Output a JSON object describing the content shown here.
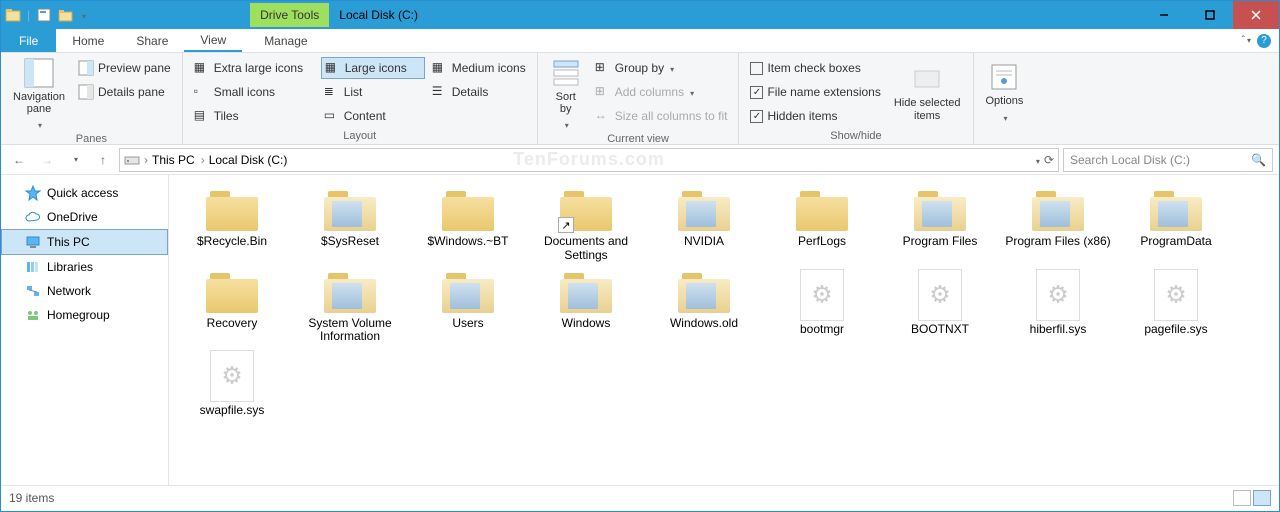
{
  "titlebar": {
    "drive_tools": "Drive Tools",
    "title": "Local Disk (C:)"
  },
  "tabs": {
    "file": "File",
    "home": "Home",
    "share": "Share",
    "view": "View",
    "manage": "Manage"
  },
  "ribbon": {
    "panes": {
      "nav": "Navigation\npane",
      "preview": "Preview pane",
      "details": "Details pane",
      "group": "Panes"
    },
    "layout": {
      "xl": "Extra large icons",
      "lg": "Large icons",
      "md": "Medium icons",
      "sm": "Small icons",
      "list": "List",
      "det": "Details",
      "tiles": "Tiles",
      "content": "Content",
      "group": "Layout"
    },
    "current": {
      "sort": "Sort\nby",
      "groupby": "Group by",
      "addcols": "Add columns",
      "sizecols": "Size all columns to fit",
      "group": "Current view"
    },
    "showhide": {
      "itemcheck": "Item check boxes",
      "fne": "File name extensions",
      "hidden": "Hidden items",
      "hidesel": "Hide selected\nitems",
      "group": "Show/hide"
    },
    "options": {
      "label": "Options"
    }
  },
  "breadcrumb": {
    "root": "This PC",
    "drive": "Local Disk (C:)"
  },
  "search": {
    "placeholder": "Search Local Disk (C:)"
  },
  "watermark": "TenForums.com",
  "sidebar": {
    "items": [
      {
        "label": "Quick access",
        "icon": "star"
      },
      {
        "label": "OneDrive",
        "icon": "cloud"
      },
      {
        "label": "This PC",
        "icon": "pc",
        "selected": true
      },
      {
        "label": "Libraries",
        "icon": "lib"
      },
      {
        "label": "Network",
        "icon": "net"
      },
      {
        "label": "Homegroup",
        "icon": "home"
      }
    ]
  },
  "files": [
    {
      "name": "$Recycle.Bin",
      "type": "folder"
    },
    {
      "name": "$SysReset",
      "type": "folder-open"
    },
    {
      "name": "$Windows.~BT",
      "type": "folder"
    },
    {
      "name": "Documents and Settings",
      "type": "folder",
      "shortcut": true
    },
    {
      "name": "NVIDIA",
      "type": "folder-open"
    },
    {
      "name": "PerfLogs",
      "type": "folder"
    },
    {
      "name": "Program Files",
      "type": "folder-open"
    },
    {
      "name": "Program Files (x86)",
      "type": "folder-open"
    },
    {
      "name": "ProgramData",
      "type": "folder-open"
    },
    {
      "name": "Recovery",
      "type": "folder"
    },
    {
      "name": "System Volume Information",
      "type": "folder-open"
    },
    {
      "name": "Users",
      "type": "folder-open"
    },
    {
      "name": "Windows",
      "type": "folder-open"
    },
    {
      "name": "Windows.old",
      "type": "folder-open"
    },
    {
      "name": "bootmgr",
      "type": "sysfile"
    },
    {
      "name": "BOOTNXT",
      "type": "sysfile"
    },
    {
      "name": "hiberfil.sys",
      "type": "sysfile"
    },
    {
      "name": "pagefile.sys",
      "type": "sysfile"
    },
    {
      "name": "swapfile.sys",
      "type": "sysfile"
    }
  ],
  "status": {
    "count": "19 items"
  }
}
